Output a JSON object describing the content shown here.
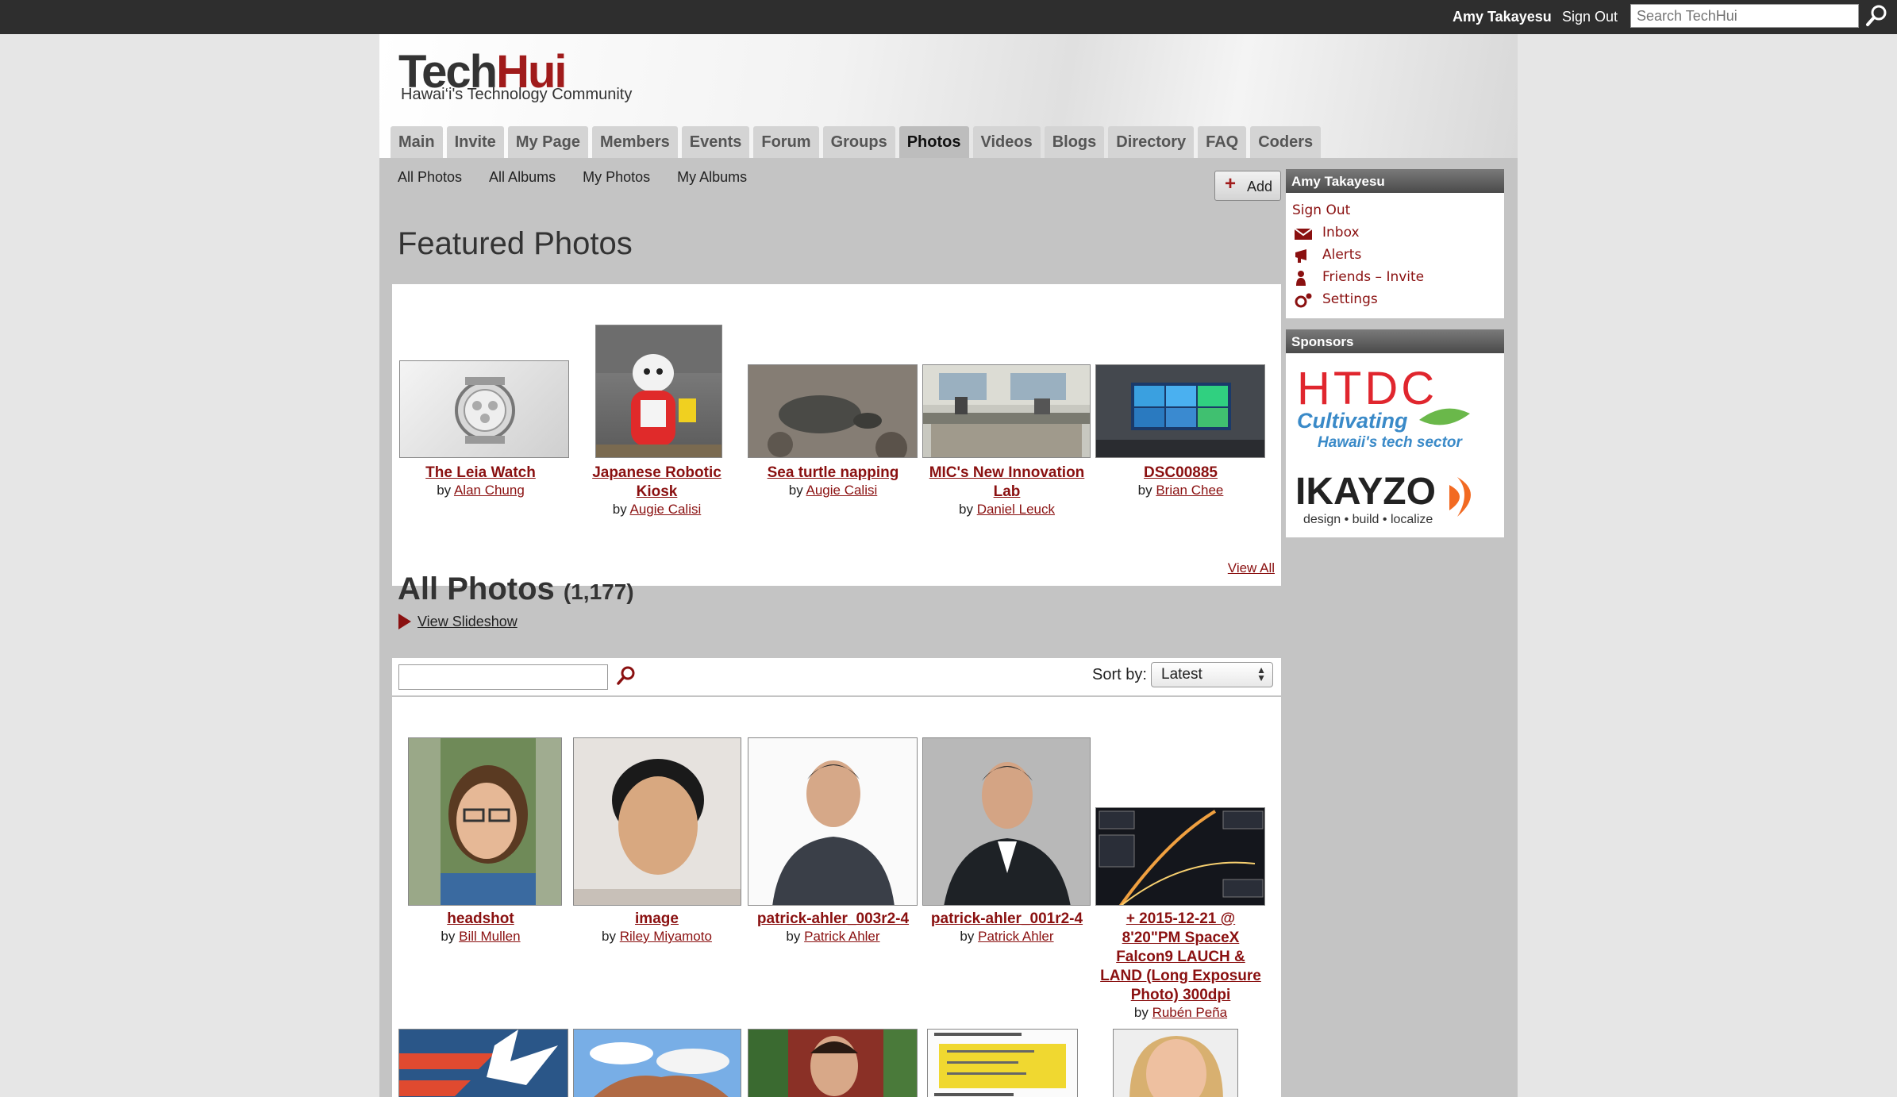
{
  "topbar": {
    "user_name": "Amy Takayesu",
    "sign_out": "Sign Out",
    "search_placeholder": "Search TechHui"
  },
  "site": {
    "logo_tech": "Tech",
    "logo_hui": "Hui",
    "tagline": "Hawai‘i's Technology Community"
  },
  "nav": {
    "tabs": [
      "Main",
      "Invite",
      "My Page",
      "Members",
      "Events",
      "Forum",
      "Groups",
      "Photos",
      "Videos",
      "Blogs",
      "Directory",
      "FAQ",
      "Coders"
    ],
    "active": "Photos"
  },
  "subnav": {
    "items": [
      "All Photos",
      "All Albums",
      "My Photos",
      "My Albums"
    ],
    "add_label": "Add"
  },
  "featured": {
    "title": "Featured Photos",
    "view_all": "View All",
    "photos": [
      {
        "title": "The Leia Watch",
        "by": "by",
        "author": "Alan Chung"
      },
      {
        "title": "Japanese Robotic",
        "title2": "Kiosk",
        "by": "by",
        "author": "Augie Calisi"
      },
      {
        "title": "Sea turtle napping",
        "by": "by",
        "author": "Augie Calisi"
      },
      {
        "title": "MIC's New Innovation",
        "title2": "Lab",
        "by": "by",
        "author": "Daniel Leuck"
      },
      {
        "title": "DSC00885",
        "by": "by",
        "author": "Brian Chee"
      }
    ]
  },
  "all_photos": {
    "title": "All Photos",
    "count": "(1,177)",
    "slideshow": "View Slideshow",
    "sort_label": "Sort by:",
    "sort_value": "Latest",
    "photos": [
      {
        "title": "headshot",
        "by": "by",
        "author": "Bill Mullen"
      },
      {
        "title": "image",
        "by": "by",
        "author": "Riley Miyamoto"
      },
      {
        "title": "patrick-ahler_003r2-4",
        "by": "by",
        "author": "Patrick Ahler"
      },
      {
        "title": "patrick-ahler_001r2-4",
        "by": "by",
        "author": "Patrick Ahler"
      },
      {
        "title_lines": [
          "+ 2015-12-21 @",
          "8'20\"PM SpaceX",
          "Falcon9 LAUCH &",
          "LAND (Long Exposure",
          "Photo) 300dpi"
        ],
        "by": "by",
        "author": "Rubén Peña"
      }
    ]
  },
  "sidebar": {
    "user_header": "Amy Takayesu",
    "sign_out": "Sign Out",
    "links": [
      {
        "label": "Inbox",
        "icon": "envelope-icon"
      },
      {
        "label": "Alerts",
        "icon": "megaphone-icon"
      },
      {
        "label": "Friends – Invite",
        "icon": "person-icon"
      },
      {
        "label": "Settings",
        "icon": "gear-icon"
      }
    ],
    "sponsors_header": "Sponsors",
    "sponsor1": {
      "name": "HTDC",
      "slogan1": "Cultivating",
      "slogan2": "Hawaii's tech sector"
    },
    "sponsor2": {
      "name": "IKAYZO",
      "slogan": "design • build • localize"
    }
  },
  "colors": {
    "brand_red": "#a01b1b",
    "link": "#8a1010",
    "topbar": "#2e2e2e"
  }
}
